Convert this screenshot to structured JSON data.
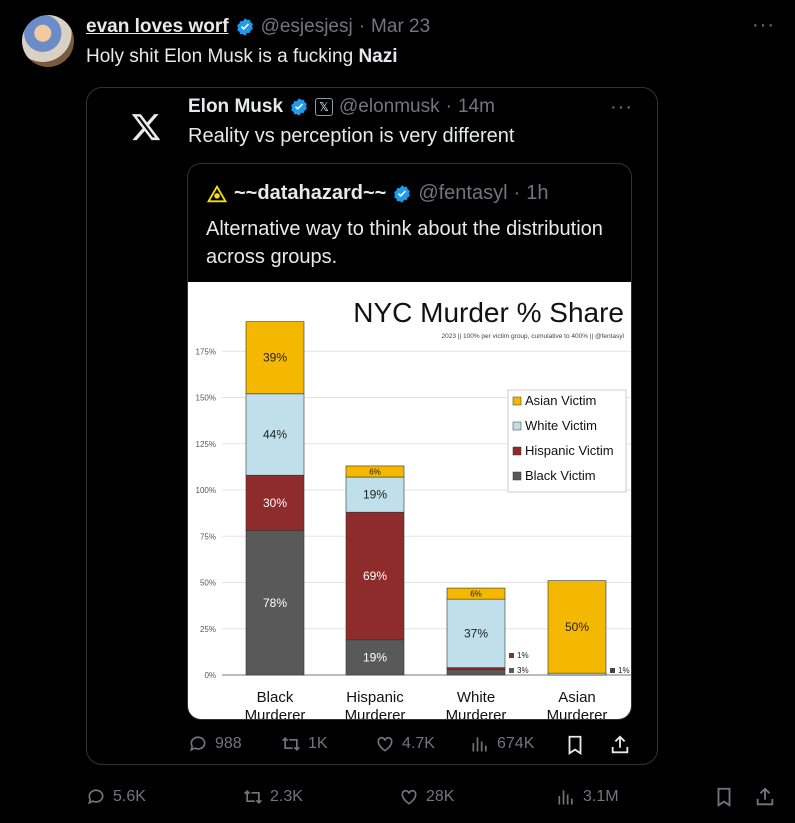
{
  "tweet": {
    "display_name": "evan loves worf",
    "handle": "@esjesjesj",
    "date": "Mar 23",
    "text_before": "Holy shit Elon Musk is a fucking ",
    "text_bold": "Nazi",
    "stats": {
      "replies": "5.6K",
      "reposts": "2.3K",
      "likes": "28K",
      "views": "3.1M"
    }
  },
  "quote": {
    "display_name": "Elon Musk",
    "handle": "@elonmusk",
    "time": "14m",
    "text": "Reality vs perception is very different",
    "stats": {
      "replies": "988",
      "reposts": "1K",
      "likes": "4.7K",
      "views": "674K"
    }
  },
  "inner_quote": {
    "display_name": "~~datahazard~~",
    "handle": "@fentasyl",
    "time": "1h",
    "text": "Alternative way to think about the distribution across groups."
  },
  "icons": {
    "verified": "verified-badge-icon",
    "x_logo": "x-logo-icon",
    "more": "more-dots-icon"
  },
  "colors": {
    "background": "#000000",
    "verified": "#1d9bf0",
    "muted": "#71767b",
    "asian": "#f5b800",
    "white": "#bfe0ea",
    "hispanic": "#8e2b2b",
    "black": "#595959"
  },
  "chart_data": {
    "type": "bar",
    "stacked": true,
    "title": "NYC Murder % Share",
    "subtitle": "2023 || 100% per victim group, cumulative to 400% || @fentasyl",
    "categories": [
      "Black Murderer",
      "Hispanic Murderer",
      "White Murderer",
      "Asian Murderer"
    ],
    "yticks": [
      "0%",
      "25%",
      "50%",
      "75%",
      "100%",
      "125%",
      "150%",
      "175%"
    ],
    "ylim": [
      0,
      190
    ],
    "legend_position": "right",
    "series": [
      {
        "name": "Black Victim",
        "color": "#595959",
        "values": [
          78,
          19,
          3,
          0
        ],
        "labels": [
          "78%",
          "19%",
          "3%",
          ""
        ]
      },
      {
        "name": "Hispanic Victim",
        "color": "#8e2b2b",
        "values": [
          30,
          69,
          1,
          0
        ],
        "labels": [
          "30%",
          "69%",
          "1%",
          ""
        ]
      },
      {
        "name": "White Victim",
        "color": "#bfe0ea",
        "values": [
          44,
          19,
          37,
          1
        ],
        "labels": [
          "44%",
          "19%",
          "37%",
          "1%"
        ]
      },
      {
        "name": "Asian Victim",
        "color": "#f5b800",
        "values": [
          39,
          6,
          6,
          50
        ],
        "labels": [
          "39%",
          "6%",
          "6%",
          "50%"
        ]
      }
    ],
    "legend_order": [
      "Asian Victim",
      "White Victim",
      "Hispanic Victim",
      "Black Victim"
    ]
  }
}
